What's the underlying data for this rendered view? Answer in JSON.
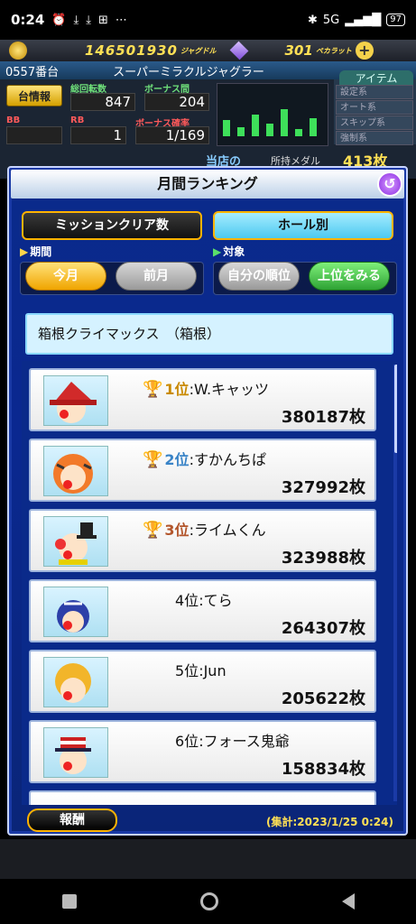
{
  "status": {
    "time": "0:24",
    "network": "5G",
    "signal": "4G",
    "battery": "97"
  },
  "header": {
    "credits": "146501930",
    "credits_unit": "ジャグドル",
    "pearls": "301",
    "pearls_unit": "ペカラット",
    "machine_number": "0557番台",
    "machine_name": "スーパーミラクルジャグラー",
    "item_title": "アイテム",
    "item_rows": [
      "設定系",
      "オート系",
      "スキップ系",
      "強制系"
    ],
    "info_button": "台情報",
    "labels": {
      "total_spins": "総回転数",
      "bonus_interval": "ボーナス間",
      "bb": "BB",
      "rb": "RB",
      "bonus_rate": "ボーナス確率"
    },
    "values": {
      "total_spins": "847",
      "bonus_interval": "204",
      "bb": "",
      "rb": "1",
      "bonus_rate": "1/169"
    },
    "today_label": "当店の",
    "medal_label": "所持メダル",
    "medal_value": "413枚"
  },
  "modal": {
    "title": "月間ランキング",
    "tabs": [
      "ミッションクリア数",
      "ホール別"
    ],
    "period_label": "期間",
    "period_options": [
      "今月",
      "前月"
    ],
    "target_label": "対象",
    "target_options": [
      "自分の順位",
      "上位をみる"
    ],
    "hall_name": "箱根クライマックス　（箱根）",
    "ranking": [
      {
        "pos": "1位",
        "name": "W.キャッツ",
        "score": "380187枚",
        "trophy": "gold"
      },
      {
        "pos": "2位",
        "name": "すかんちぱ",
        "score": "327992枚",
        "trophy": "silver"
      },
      {
        "pos": "3位",
        "name": "ライムくん",
        "score": "323988枚",
        "trophy": "bronze"
      },
      {
        "pos": "4位",
        "name": "てら",
        "score": "264307枚",
        "trophy": ""
      },
      {
        "pos": "5位",
        "name": "Jun",
        "score": "205622枚",
        "trophy": ""
      },
      {
        "pos": "6位",
        "name": "フォース鬼爺",
        "score": "158834枚",
        "trophy": ""
      }
    ],
    "reward_button": "報酬",
    "aggregated": "(集計:2023/1/25 0:24)"
  }
}
